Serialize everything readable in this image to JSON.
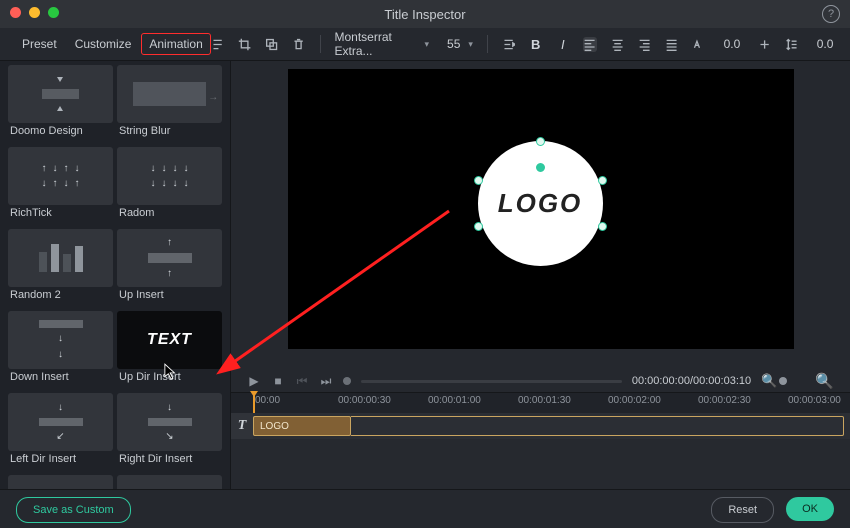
{
  "window": {
    "title": "Title Inspector"
  },
  "tabs": {
    "preset": "Preset",
    "customize": "Customize",
    "animation": "Animation"
  },
  "font": {
    "family": "Montserrat Extra...",
    "size": "55"
  },
  "numbers": {
    "letterSpacing": "0.0",
    "lineHeight": "0.0"
  },
  "presets": [
    {
      "label": "Doomo Design"
    },
    {
      "label": "String Blur"
    },
    {
      "label": "RichTick"
    },
    {
      "label": "Radom"
    },
    {
      "label": "Random 2"
    },
    {
      "label": "Up Insert"
    },
    {
      "label": "Down Insert"
    },
    {
      "label": "Up Dir Insert",
      "preview_text": "TEXT"
    },
    {
      "label": "Left Dir Insert"
    },
    {
      "label": "Right Dir Insert"
    }
  ],
  "preview": {
    "logo_text": "LOGO"
  },
  "timecode": {
    "display": "00:00:00:00/00:00:03:10"
  },
  "ruler": [
    "00:00",
    "00:00:00:30",
    "00:00:01:00",
    "00:00:01:30",
    "00:00:02:00",
    "00:00:02:30",
    "00:00:03:00"
  ],
  "clip": {
    "name": "LOGO"
  },
  "footer": {
    "save": "Save as Custom",
    "reset": "Reset",
    "ok": "OK"
  },
  "colors": {
    "accent": "#2fc99f",
    "highlightRed": "#ff2d2d"
  }
}
